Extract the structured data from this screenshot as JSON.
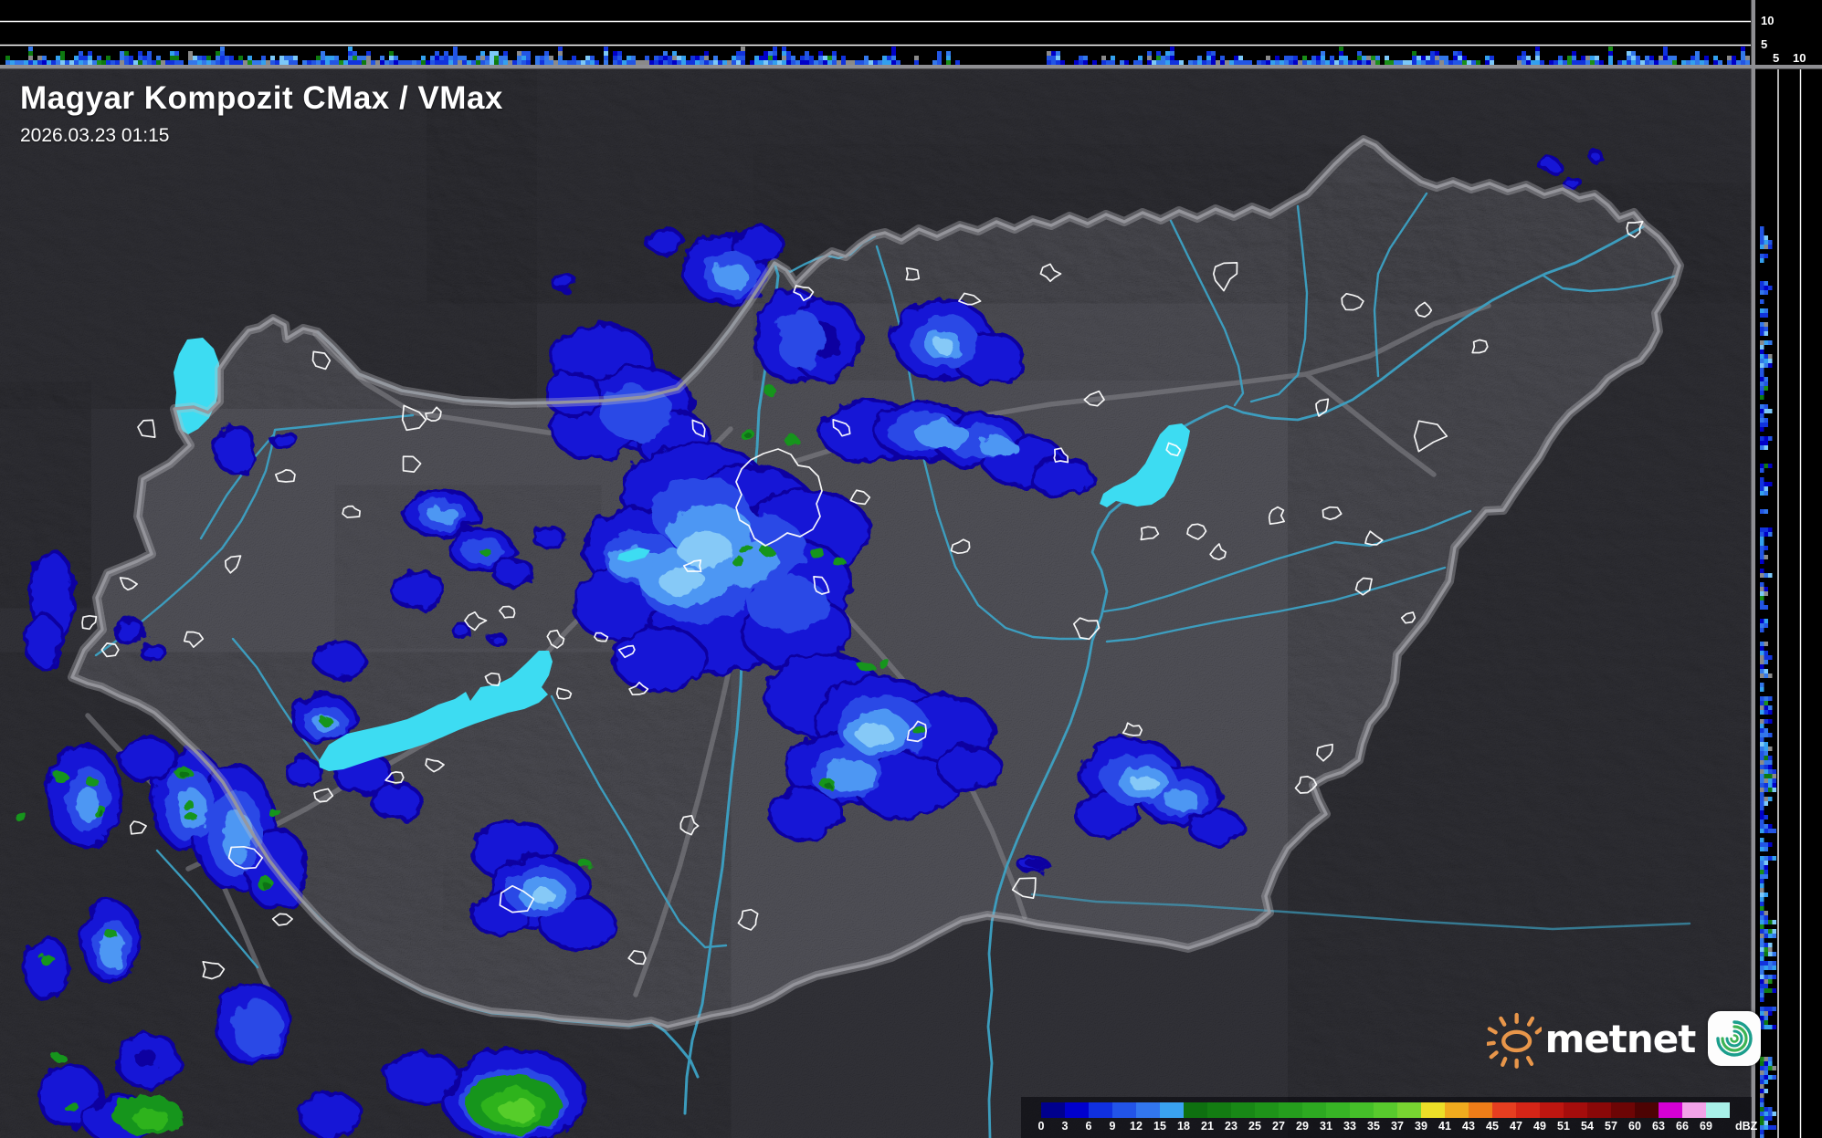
{
  "header": {
    "title": "Magyar Kompozit CMax / VMax",
    "timestamp": "2026.03.23 01:15"
  },
  "legend": {
    "unit": "dBZ",
    "ticks": [
      "0",
      "3",
      "6",
      "9",
      "12",
      "15",
      "18",
      "21",
      "23",
      "25",
      "27",
      "29",
      "31",
      "33",
      "35",
      "37",
      "39",
      "41",
      "43",
      "45",
      "47",
      "49",
      "51",
      "54",
      "57",
      "60",
      "63",
      "66",
      "69"
    ],
    "colors": [
      "#00008e",
      "#0000cd",
      "#1030e0",
      "#2254e8",
      "#3276ee",
      "#3aa2f0",
      "#0e7010",
      "#137c12",
      "#188816",
      "#1e9319",
      "#259e1d",
      "#2da921",
      "#37b425",
      "#45bf29",
      "#58ca2d",
      "#78d431",
      "#ecdf28",
      "#f0ab1e",
      "#ee7d18",
      "#e63e20",
      "#d52517",
      "#bd1610",
      "#a40d0c",
      "#8a0808",
      "#6d0505",
      "#4d0303",
      "#d400d4",
      "#f2a2e8",
      "#a8f0e8"
    ]
  },
  "axes": {
    "top_profile": {
      "labels": [
        "10",
        "5"
      ]
    },
    "right_profile": {
      "labels": [
        "5",
        "10"
      ]
    }
  },
  "branding": {
    "name": "metnet",
    "sun_color": "#e8964a",
    "icon_colors": [
      "#1b9e8c",
      "#3cb454"
    ]
  },
  "colors": {
    "water": "#3ddcf2",
    "river": "#3da2c4",
    "border": "#97979d",
    "road": "#87878c",
    "settlement_outline": "#ffffff",
    "land_inside": "#4f4f56",
    "land_outside": "#2e2e33",
    "echo_palette": [
      "#0806a0",
      "#1513d6",
      "#2b49e6",
      "#4e97f3",
      "#86c9f7",
      "#17951c",
      "#0c7212",
      "#2fb31f",
      "#57cd2a"
    ]
  },
  "side_views": {
    "seed": 42,
    "palette": [
      "#0000c8",
      "#1133dd",
      "#2255e4",
      "#3377ea",
      "#33a0ee",
      "#7cc8f8",
      "#1a8f18",
      "#0e7a10",
      "#8a8a8a",
      "#0a0aa0"
    ]
  }
}
